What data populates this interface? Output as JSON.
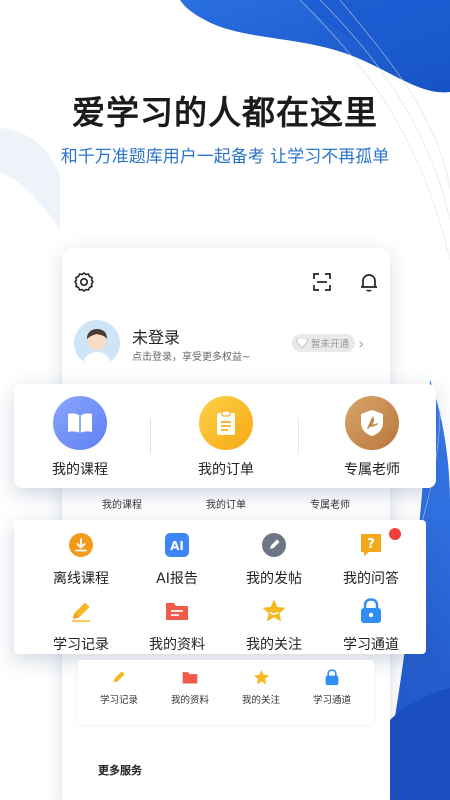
{
  "hero": {
    "title": "爱学习的人都在这里",
    "subtitle": "和千万准题库用户一起备考 让学习不再孤单"
  },
  "profile": {
    "name": "未登录",
    "tip": "点击登录，享受更多权益~",
    "badge": "暂未开通"
  },
  "main_menu": [
    {
      "label": "我的课程",
      "icon": "book-icon",
      "color": "#6f8ff5"
    },
    {
      "label": "我的订单",
      "icon": "clipboard-icon",
      "color": "#f6b820"
    },
    {
      "label": "专属老师",
      "icon": "teacher-shield-icon",
      "color": "#c9884a"
    }
  ],
  "main_menu_small": [
    "我的课程",
    "我的订单",
    "专属老师"
  ],
  "features": [
    {
      "label": "离线课程",
      "icon": "download-icon"
    },
    {
      "label": "AI报告",
      "icon": "ai-icon"
    },
    {
      "label": "我的发帖",
      "icon": "post-icon"
    },
    {
      "label": "我的问答",
      "icon": "question-icon"
    },
    {
      "label": "学习记录",
      "icon": "pencil-icon"
    },
    {
      "label": "我的资料",
      "icon": "folder-icon"
    },
    {
      "label": "我的关注",
      "icon": "star-icon"
    },
    {
      "label": "学习通道",
      "icon": "lock-icon"
    }
  ],
  "features_small": [
    "学习记录",
    "我的资料",
    "我的关注",
    "学习通道"
  ],
  "more_services": "更多服务",
  "colors": {
    "brand_blue": "#1e63d8",
    "subtitle_blue": "#2a74c9",
    "orange": "#f39a1c",
    "red_dot": "#f0423a"
  }
}
